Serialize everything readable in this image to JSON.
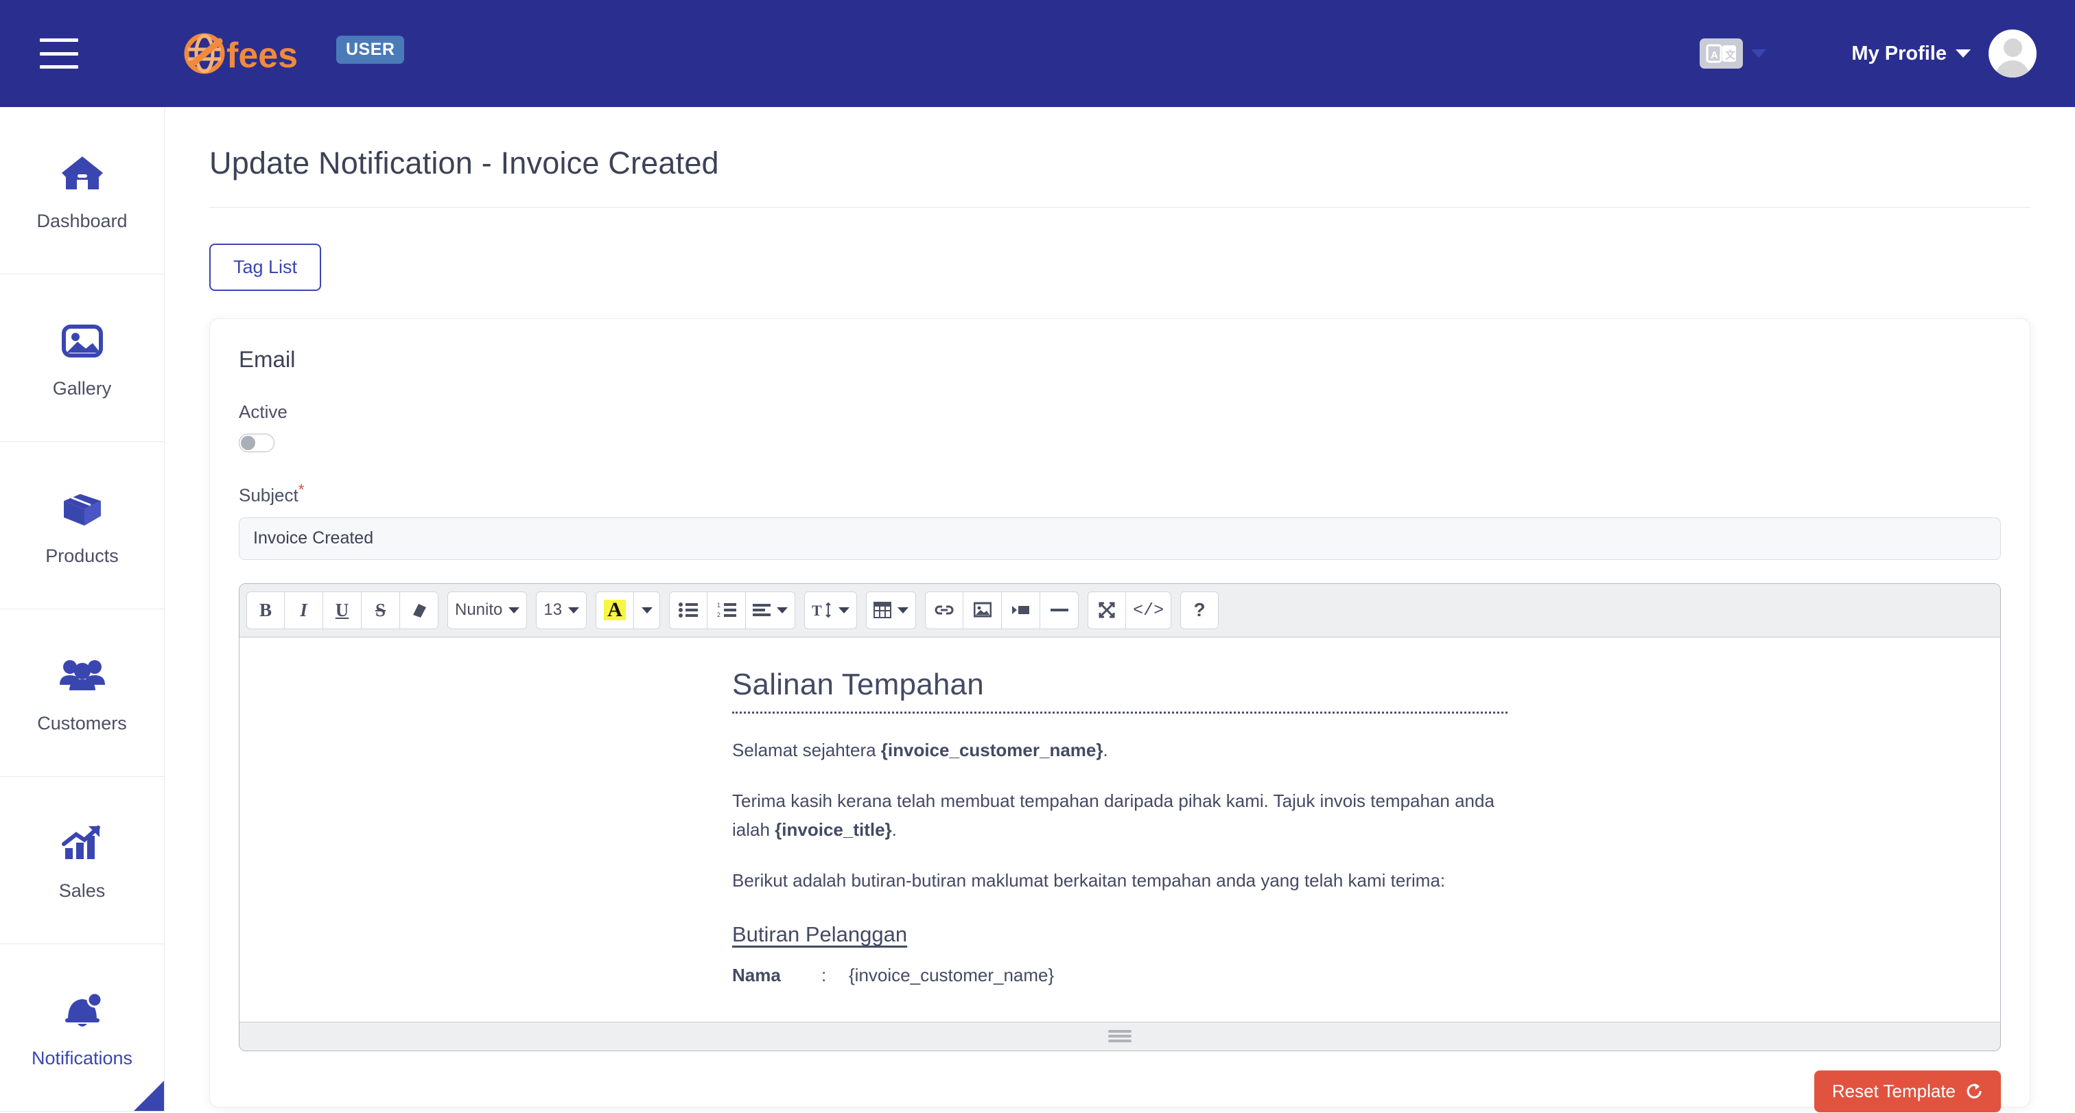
{
  "header": {
    "menu_icon": "hamburger-icon",
    "brand_name": "Fees",
    "brand_badge": "USER",
    "language_icon": "translate-icon",
    "profile_label": "My Profile",
    "avatar_icon": "user-avatar-icon"
  },
  "sidebar": {
    "items": [
      {
        "label": "Dashboard",
        "icon": "home-icon",
        "active": false
      },
      {
        "label": "Gallery",
        "icon": "image-icon",
        "active": false
      },
      {
        "label": "Products",
        "icon": "box-icon",
        "active": false
      },
      {
        "label": "Customers",
        "icon": "people-icon",
        "active": false
      },
      {
        "label": "Sales",
        "icon": "chart-growth-icon",
        "active": false
      },
      {
        "label": "Notifications",
        "icon": "bell-icon",
        "active": true
      }
    ]
  },
  "page": {
    "title": "Update Notification - Invoice Created",
    "tag_list_button": "Tag List"
  },
  "card": {
    "title": "Email",
    "active_label": "Active",
    "active_on": false,
    "subject_label": "Subject",
    "subject_required_mark": "*",
    "subject_value": "Invoice Created",
    "reset_button": "Reset Template",
    "reset_icon": "refresh-icon"
  },
  "toolbar": {
    "bold": "B",
    "italic": "I",
    "underline": "U",
    "strikethrough": "S",
    "remove_format_icon": "eraser-icon",
    "font_family": "Nunito",
    "font_size": "13",
    "highlight_letter": "A",
    "unordered_list_icon": "bullet-list-icon",
    "ordered_list_icon": "numbered-list-icon",
    "align_icon": "align-left-icon",
    "line_height_icon": "line-height-icon",
    "table_icon": "table-icon",
    "link_icon": "link-icon",
    "image_icon": "image-icon",
    "video_icon": "video-icon",
    "hr_icon": "horizontal-rule-icon",
    "fullscreen_icon": "expand-icon",
    "code_view": "</>",
    "help": "?"
  },
  "document": {
    "heading": "Salinan Tempahan",
    "p1_pre": "Selamat sejahtera ",
    "p1_tag": "{invoice_customer_name}",
    "p1_post": ".",
    "p2_pre": "Terima kasih kerana telah membuat tempahan daripada pihak kami. Tajuk invois tempahan anda ialah ",
    "p2_tag": "{invoice_title}",
    "p2_post": ".",
    "p3": "Berikut adalah butiran-butiran maklumat berkaitan tempahan anda yang telah kami terima:",
    "subheading": "Butiran Pelanggan",
    "row_key": "Nama",
    "row_colon": ":",
    "row_value": "{invoice_customer_name}"
  },
  "colors": {
    "brand_navy": "#2a2f8f",
    "accent_blue": "#3a46b0",
    "logo_orange": "#f08a3c",
    "badge_blue": "#4a7ab8",
    "danger_red": "#e2533f",
    "required_star": "#e8483c",
    "highlight_yellow": "#f8f543"
  }
}
